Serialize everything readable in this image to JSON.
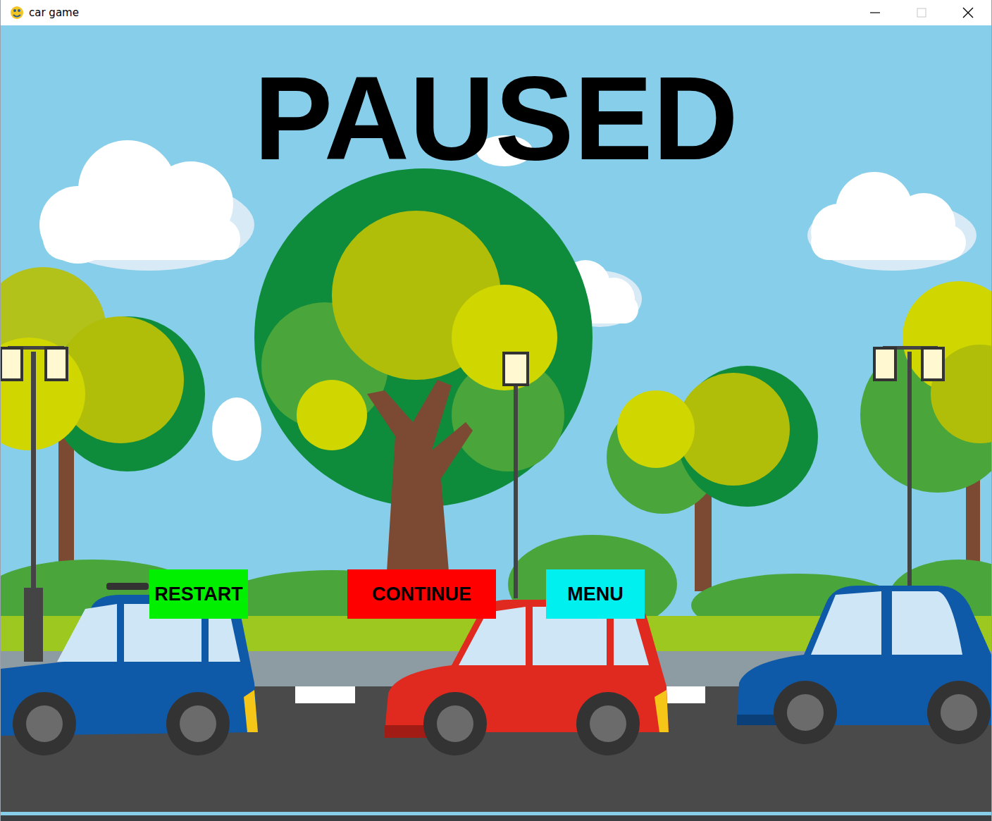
{
  "window": {
    "title": "car game"
  },
  "heading": "PAUSED",
  "buttons": [
    {
      "label": "RESTART",
      "color": "#00f000"
    },
    {
      "label": "CONTINUE",
      "color": "#ff0000"
    },
    {
      "label": "MENU",
      "color": "#00f0f0"
    }
  ]
}
